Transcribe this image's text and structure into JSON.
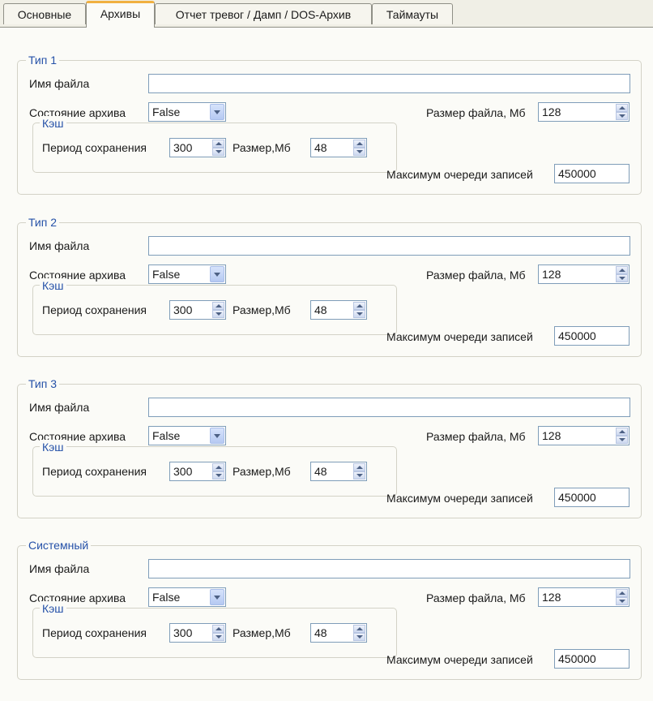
{
  "tabs": [
    {
      "label": "Основные"
    },
    {
      "label": "Архивы"
    },
    {
      "label": "Отчет тревог / Дамп / DOS-Архив"
    },
    {
      "label": "Таймауты"
    }
  ],
  "labels": {
    "file_name": "Имя файла",
    "archive_state": "Состояние архива",
    "file_size": "Размер файла, Мб",
    "cache": "Кэш",
    "save_period": "Период сохранения",
    "cache_size": "Размер,Мб",
    "max_queue": "Максимум очереди записей"
  },
  "groups": [
    {
      "title": "Тип 1",
      "file_name": "",
      "archive_state": "False",
      "file_size": "128",
      "save_period": "300",
      "cache_size": "48",
      "max_queue": "450000"
    },
    {
      "title": "Тип 2",
      "file_name": "",
      "archive_state": "False",
      "file_size": "128",
      "save_period": "300",
      "cache_size": "48",
      "max_queue": "450000"
    },
    {
      "title": "Тип 3",
      "file_name": "",
      "archive_state": "False",
      "file_size": "128",
      "save_period": "300",
      "cache_size": "48",
      "max_queue": "450000"
    },
    {
      "title": "Системный",
      "file_name": "",
      "archive_state": "False",
      "file_size": "128",
      "save_period": "300",
      "cache_size": "48",
      "max_queue": "450000"
    }
  ]
}
